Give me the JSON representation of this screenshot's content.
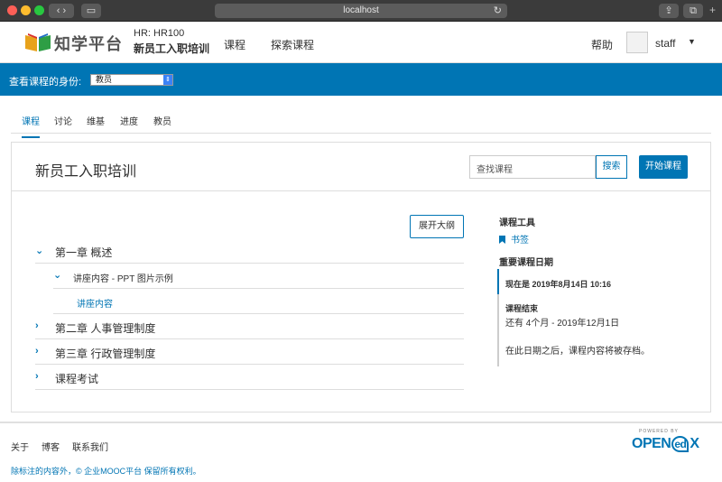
{
  "browser": {
    "url": "localhost"
  },
  "header": {
    "logo_text": "知学平台",
    "course_code": "HR: HR100",
    "course_name": "新员工入职培训",
    "nav": [
      "课程",
      "探索课程"
    ],
    "help": "帮助",
    "username": "staff"
  },
  "rolebar": {
    "label": "查看课程的身份:",
    "selected": "教员"
  },
  "tabs": [
    "课程",
    "讨论",
    "维基",
    "进度",
    "教员"
  ],
  "course": {
    "title": "新员工入职培训",
    "search_placeholder": "查找课程",
    "search_button": "搜索",
    "start_button": "开始课程",
    "expand_button": "展开大纲",
    "chapters": [
      {
        "title": "第一章 概述",
        "expanded": true
      },
      {
        "title": "第二章 人事管理制度",
        "expanded": false
      },
      {
        "title": "第三章 行政管理制度",
        "expanded": false
      },
      {
        "title": "课程考试",
        "expanded": false
      }
    ],
    "sub_section": "讲座内容 - PPT 图片示例",
    "unit_link": "讲座内容"
  },
  "tools": {
    "title": "课程工具",
    "bookmark": "书签",
    "dates_title": "重要课程日期",
    "today": "现在是 2019年8月14日 10:16",
    "end_label": "课程结束",
    "end_value": "还有 4个月 - 2019年12月1日",
    "note": "在此日期之后，课程内容将被存档。"
  },
  "footer": {
    "links": [
      "关于",
      "博客",
      "联系我们"
    ],
    "copyright": "除标注的内容外，© 企业MOOC平台 保留所有权利。",
    "powered": "POWERED BY",
    "brand_pre": "OPEN",
    "brand_ed": "ed",
    "brand_x": "X"
  },
  "colors": {
    "accent": "#0075b4"
  }
}
